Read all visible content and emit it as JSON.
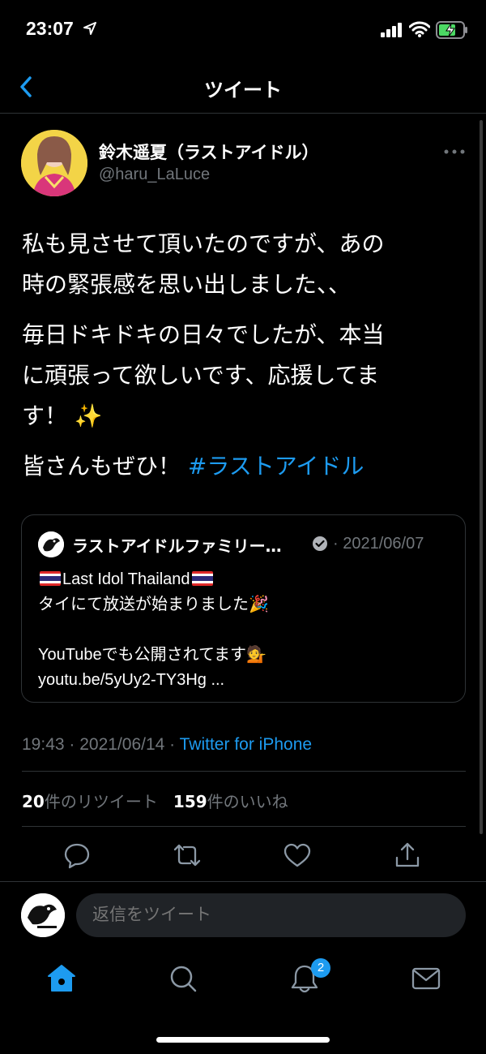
{
  "status_bar": {
    "time": "23:07"
  },
  "nav": {
    "title": "ツイート"
  },
  "tweet": {
    "display_name": "鈴木遥夏（ラストアイドル）",
    "handle": "@haru_LaLuce",
    "body": {
      "p1_line1": "私も見させて頂いたのですが、あの",
      "p1_line2": "時の緊張感を思い出しました、、",
      "p2_line1": "毎日ドキドキの日々でしたが、本当",
      "p2_line2": "に頑張って欲しいです、応援してま",
      "p2_line3": "す！",
      "p2_emoji": "✨",
      "p3_text": "皆さんもぜひ！ ",
      "p3_hashtag": "#ラストアイドル"
    },
    "time": "19:43",
    "date": "2021/06/14",
    "source": "Twitter for iPhone",
    "retweet_count": "20",
    "retweet_label": "件のリツイート",
    "like_count": "159",
    "like_label": "件のいいね"
  },
  "quote": {
    "name": "ラストアイドルファミリー…",
    "date": "· 2021/06/07",
    "line1": "Last Idol Thailand",
    "line2": "タイにて放送が始まりました",
    "line2_emoji": "🎉",
    "line3": "YouTubeでも公開されてます",
    "line3_emoji": "💁",
    "line4": "youtu.be/5yUy2-TY3Hg  ..."
  },
  "reply": {
    "placeholder": "返信をツイート"
  },
  "tab_bar": {
    "notification_count": "2"
  },
  "colors": {
    "accent": "#1d9bf0",
    "background": "#000000",
    "muted": "#71767b",
    "border": "#2f3336"
  }
}
